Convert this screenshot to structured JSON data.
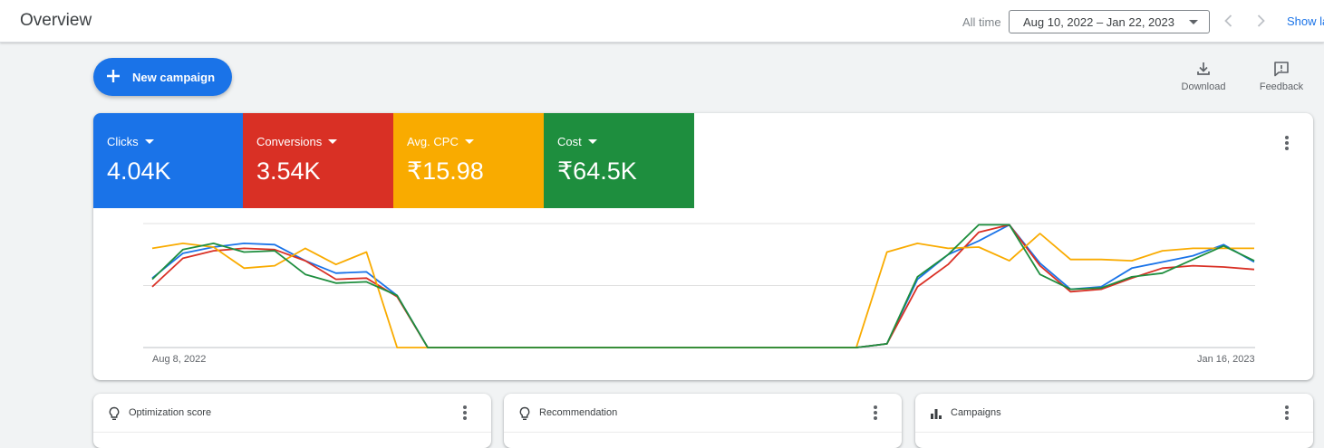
{
  "header": {
    "title": "Overview",
    "range_label": "All time",
    "date_range": "Aug 10, 2022 – Jan 22, 2023",
    "show_label": "Show la"
  },
  "toolbar": {
    "new_campaign_label": "New campaign",
    "download_label": "Download",
    "feedback_label": "Feedback"
  },
  "metrics": [
    {
      "label": "Clicks",
      "value": "4.04K",
      "color": "#1a73e8"
    },
    {
      "label": "Conversions",
      "value": "3.54K",
      "color": "#d93025"
    },
    {
      "label": "Avg. CPC",
      "value": "₹15.98",
      "color": "#f9ab00"
    },
    {
      "label": "Cost",
      "value": "₹64.5K",
      "color": "#1e8e3e"
    }
  ],
  "chart_data": {
    "type": "line",
    "x_start": "Aug 8, 2022",
    "x_end": "Jan 16, 2023",
    "tick_labels": [
      "Aug 8, 2022",
      "Jan 16, 2023"
    ],
    "x": [
      1,
      2,
      3,
      4,
      5,
      6,
      7,
      8,
      9,
      10,
      11,
      12,
      13,
      14,
      15,
      16,
      17,
      18,
      19,
      20,
      21,
      22,
      23,
      24,
      25,
      26,
      27,
      28,
      29,
      30,
      31,
      32,
      33,
      34,
      35,
      36,
      37,
      38,
      39,
      40,
      41,
      42,
      43,
      44,
      45,
      46,
      47
    ],
    "ylim": [
      0,
      100
    ],
    "grid": true,
    "series": [
      {
        "color": "#1a73e8",
        "values": [
          56,
          76,
          81,
          84,
          83,
          70,
          60,
          61,
          42,
          0,
          0,
          0,
          0,
          0,
          0,
          0,
          0,
          0,
          0,
          0,
          0,
          0,
          0,
          0,
          3,
          55,
          75,
          86,
          99,
          68,
          47,
          49,
          64,
          69,
          74,
          83,
          69
        ]
      },
      {
        "color": "#d93025",
        "values": [
          49,
          72,
          78,
          80,
          79,
          70,
          55,
          56,
          41,
          0,
          0,
          0,
          0,
          0,
          0,
          0,
          0,
          0,
          0,
          0,
          0,
          0,
          0,
          0,
          3,
          49,
          67,
          93,
          99,
          66,
          45,
          47,
          56,
          64,
          66,
          65,
          63
        ]
      },
      {
        "color": "#f9ab00",
        "values": [
          80,
          84,
          81,
          64,
          66,
          80,
          67,
          77,
          0,
          0,
          0,
          0,
          0,
          0,
          0,
          0,
          0,
          0,
          0,
          0,
          0,
          0,
          0,
          0,
          77,
          84,
          80,
          81,
          70,
          92,
          71,
          71,
          70,
          78,
          80,
          80,
          80
        ]
      },
      {
        "color": "#1e8e3e",
        "values": [
          55,
          79,
          84,
          77,
          78,
          59,
          52,
          53,
          42,
          0,
          0,
          0,
          0,
          0,
          0,
          0,
          0,
          0,
          0,
          0,
          0,
          0,
          0,
          0,
          3,
          57,
          75,
          99,
          99,
          59,
          47,
          48,
          57,
          60,
          71,
          82,
          70
        ]
      }
    ]
  },
  "cards": [
    {
      "title": "Optimization score"
    },
    {
      "title": "Recommendation"
    },
    {
      "title": "Campaigns"
    }
  ]
}
